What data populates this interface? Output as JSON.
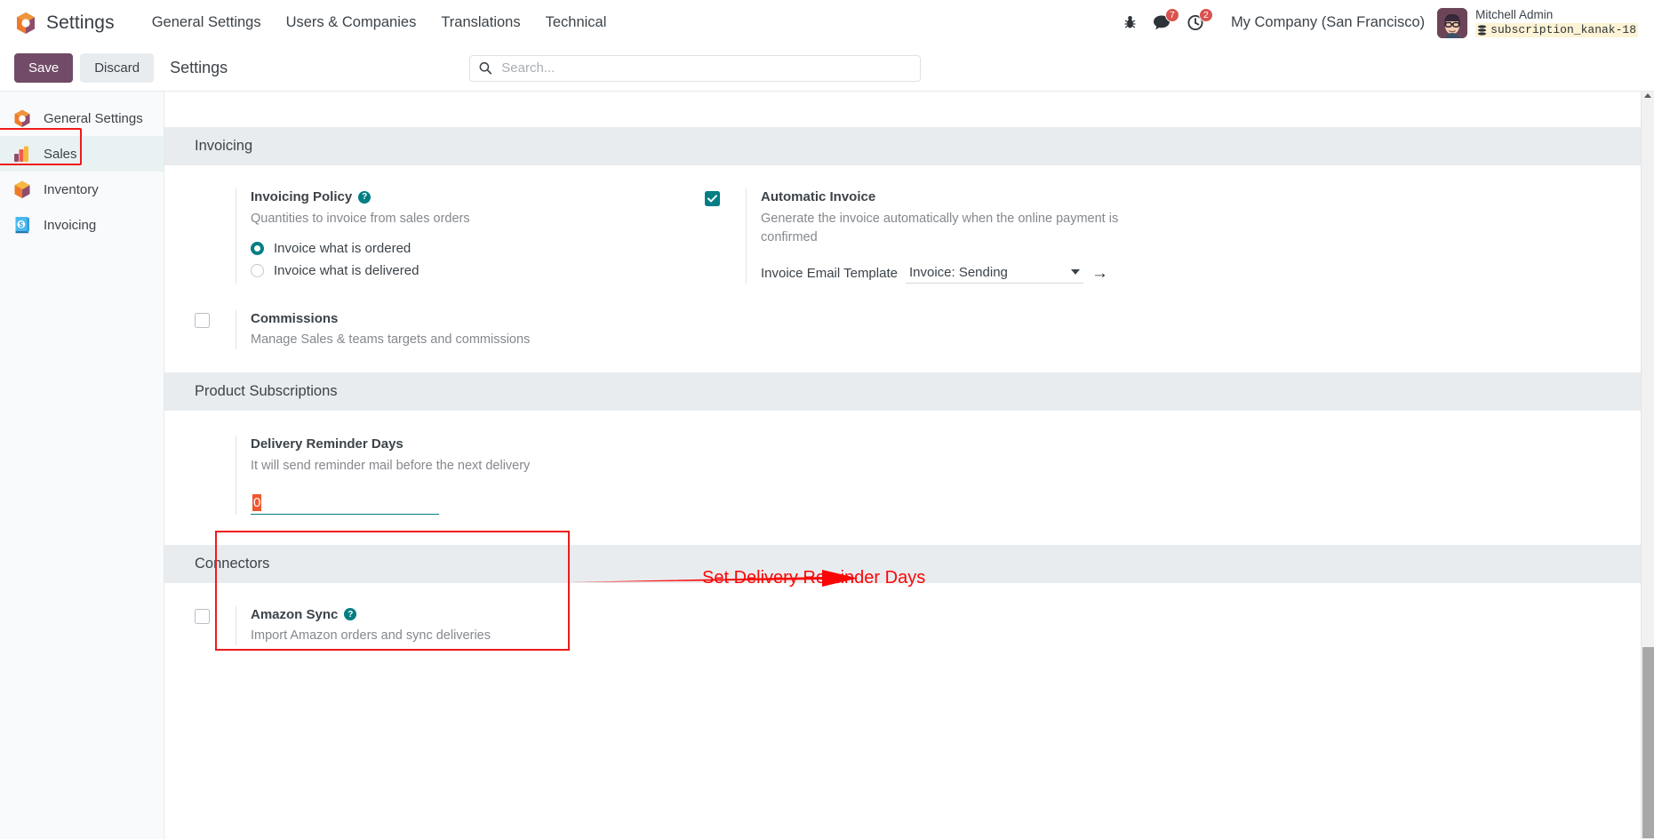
{
  "navbar": {
    "brand": "Settings",
    "logo_icon": "odoo-logo-icon",
    "menu": [
      {
        "label": "General Settings",
        "name": "nav-general-settings"
      },
      {
        "label": "Users & Companies",
        "name": "nav-users-companies"
      },
      {
        "label": "Translations",
        "name": "nav-translations"
      },
      {
        "label": "Technical",
        "name": "nav-technical"
      }
    ],
    "debug_icon": "bug-icon",
    "messages_icon": "chat-bubble-icon",
    "messages_count": "7",
    "activities_icon": "clock-icon",
    "activities_count": "2",
    "company": "My Company (San Francisco)",
    "user_name": "Mitchell Admin",
    "database": "subscription_kanak-18",
    "database_icon": "database-icon",
    "avatar_icon": "user-avatar"
  },
  "controlpanel": {
    "save_label": "Save",
    "discard_label": "Discard",
    "title": "Settings",
    "search_placeholder": "Search...",
    "search_value": "",
    "search_icon": "search-icon"
  },
  "sidebar": {
    "items": [
      {
        "label": "General Settings",
        "name": "sidebar-item-general-settings",
        "icon": "odoo-settings-icon",
        "active": false
      },
      {
        "label": "Sales",
        "name": "sidebar-item-sales",
        "icon": "sales-chart-icon",
        "active": true
      },
      {
        "label": "Inventory",
        "name": "sidebar-item-inventory",
        "icon": "inventory-box-icon",
        "active": false
      },
      {
        "label": "Invoicing",
        "name": "sidebar-item-invoicing",
        "icon": "invoicing-dollar-icon",
        "active": false
      }
    ]
  },
  "sections": {
    "invoicing": {
      "title": "Invoicing",
      "invoicing_policy": {
        "label": "Invoicing Policy",
        "help_icon": "question-mark-icon",
        "description": "Quantities to invoice from sales orders",
        "options": [
          {
            "label": "Invoice what is ordered",
            "selected": true
          },
          {
            "label": "Invoice what is delivered",
            "selected": false
          }
        ]
      },
      "automatic_invoice": {
        "label": "Automatic Invoice",
        "checked": true,
        "description": "Generate the invoice automatically when the online payment is confirmed",
        "field_label": "Invoice Email Template",
        "field_value": "Invoice: Sending",
        "external_link_icon": "arrow-right-icon",
        "caret_icon": "chevron-down-icon"
      },
      "commissions": {
        "label": "Commissions",
        "checked": false,
        "description": "Manage Sales & teams targets and commissions"
      }
    },
    "product_subscriptions": {
      "title": "Product Subscriptions",
      "delivery_reminder": {
        "label": "Delivery Reminder Days",
        "description": "It will send reminder mail before the next delivery",
        "value": "0"
      }
    },
    "connectors": {
      "title": "Connectors",
      "amazon_sync": {
        "label": "Amazon Sync",
        "help_icon": "question-mark-icon",
        "checked": false,
        "description": "Import Amazon orders and sync deliveries"
      }
    }
  },
  "annotations": {
    "callout_text": "Set Delivery Reminder Days",
    "highlight_color": "#ef1a1a",
    "arrow_icon": "red-arrow-icon"
  },
  "colors": {
    "primary": "#714b67",
    "accent_teal": "#017e84",
    "section_header_bg": "#e9ecef",
    "annotation_red": "#fb0606",
    "selection_orange": "#f0562d"
  },
  "scrollbar": {
    "up_arrow_icon": "scroll-up-arrow-icon",
    "thumb_name": "vertical-scroll-thumb"
  }
}
